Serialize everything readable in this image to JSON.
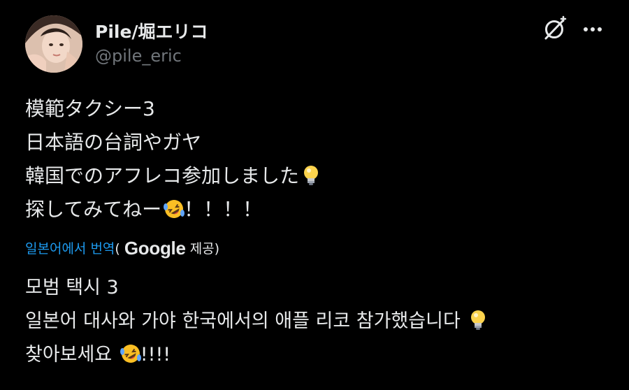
{
  "author": {
    "name": "Pile/堀エリコ",
    "handle": "@pile_eric"
  },
  "icons": {
    "avatar": "profile-photo",
    "grok": "grok-icon",
    "more": "more-horizontal-icon",
    "bulb": "light-bulb-emoji",
    "rofl": "rolling-on-floor-laughing-emoji"
  },
  "post": {
    "lines": [
      "模範タクシー3",
      "日本語の台詞やガヤ",
      "韓国でのアフレコ参加しました",
      "探してみてねー"
    ],
    "line4_tail": "！！！！"
  },
  "translation": {
    "link_label": "일본어에서 번역",
    "open_paren": "(",
    "provider": "Google",
    "provided_label": "제공)",
    "lines": [
      "모범 택시 3",
      "일본어 대사와 가야 한국에서의 애플 리코 참가했습니다",
      "찾아보세요"
    ],
    "line3_tail": "!!!!"
  },
  "colors": {
    "background": "#000000",
    "text": "#e7e9ea",
    "handle": "#71767b",
    "link": "#1d9bf0"
  }
}
